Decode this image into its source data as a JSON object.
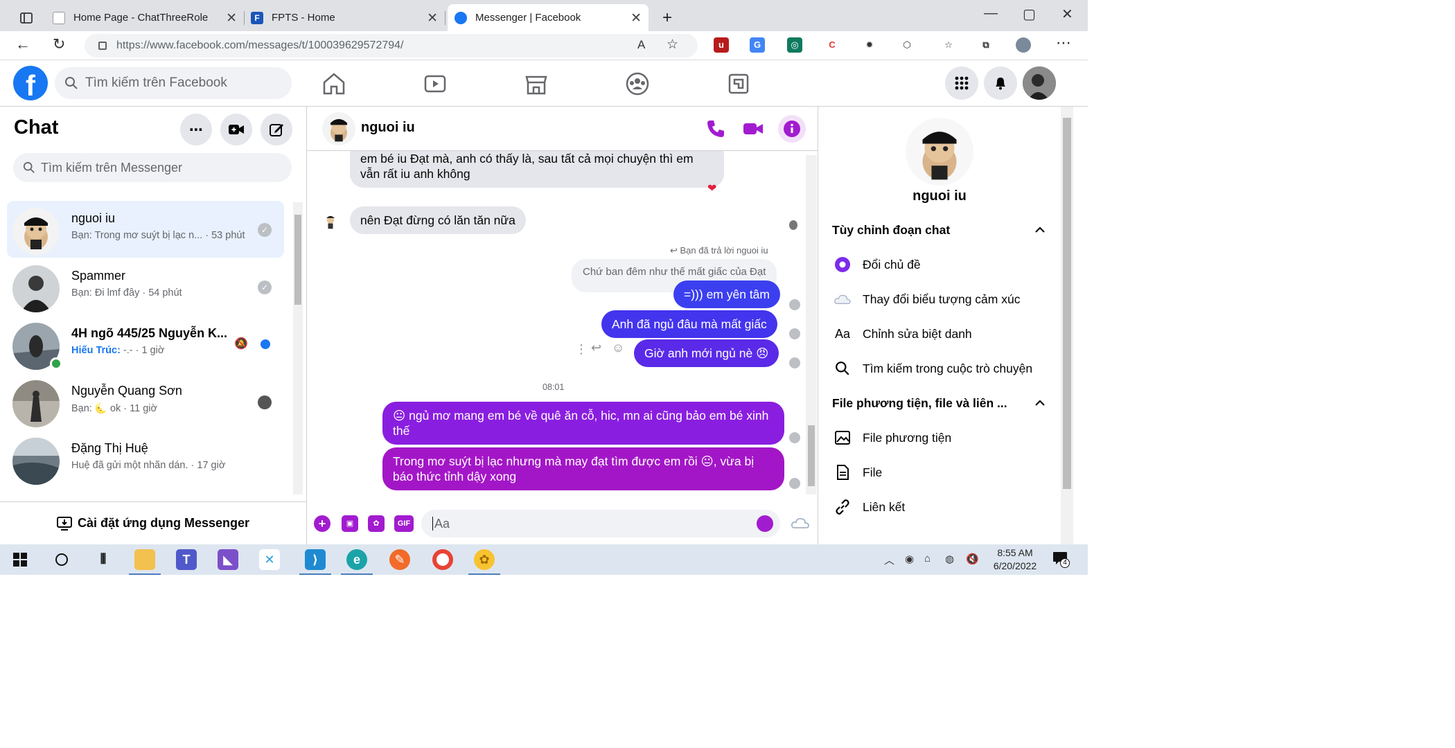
{
  "browser": {
    "tabs": [
      {
        "title": "Home Page - ChatThreeRole",
        "active": false
      },
      {
        "title": "FPTS - Home",
        "active": false
      },
      {
        "title": "Messenger | Facebook",
        "active": true
      }
    ],
    "new_tab": "+",
    "url": "https://www.facebook.com/messages/t/100039629572794/",
    "window_controls": {
      "minimize": "—",
      "maximize": "▢",
      "close": "✕"
    }
  },
  "facebook": {
    "logo": "f",
    "search_placeholder": "Tìm kiếm trên Facebook"
  },
  "chat_list": {
    "title": "Chat",
    "search_placeholder": "Tìm kiếm trên Messenger",
    "conversations": [
      {
        "name": "nguoi iu",
        "preview": "Bạn: Trong mơ suýt bị lạc n... · 53 phút",
        "selected": true
      },
      {
        "name": "Spammer",
        "preview": "Bạn: Đi lmf đây · 54 phút",
        "selected": false
      },
      {
        "name": "4H ngõ 445/25 Nguyễn K...",
        "preview_sender": "Hiếu Trúc:",
        "preview": " -.- · 1 giờ",
        "selected": false,
        "unread": true
      },
      {
        "name": "Nguyễn Quang Sơn",
        "preview": "Bạn: 🌜 ok · 11 giờ",
        "selected": false
      },
      {
        "name": "Đặng Thị Huệ",
        "preview": "Huệ đã gửi một nhãn dán. · 17 giờ",
        "selected": false
      }
    ],
    "install_label": "Cài đặt ứng dụng Messenger"
  },
  "conversation": {
    "contact_name": "nguoi iu",
    "messages": {
      "incoming_1": "em bé iu Đạt mà, anh có thấy là, sau tất cả mọi chuyện thì em vẫn rất iu anh không",
      "incoming_1_reaction": "❤",
      "incoming_2": "nên Đạt đừng có lăn tăn nữa",
      "reply_note": "↩ Bạn đã trả lời nguoi iu",
      "quoted": "Chứ ban đêm như thế mất giấc của Đạt",
      "out_1": "=))) em yên tâm",
      "out_2": "Anh đã ngủ đâu mà mất giấc",
      "out_3": "Giờ anh mới ngủ nè 😠",
      "timestamp": "08:01",
      "out_4": "😐 ngủ mơ mang em bé về quê ăn cỗ, hic, mn ai cũng bảo em bé xinh thế",
      "out_5": "Trong mơ suýt bị lạc nhưng mà may đạt tìm được em rồi 😐, vừa bị báo thức tỉnh dậy xong"
    },
    "input_placeholder": "Aa",
    "composer_icons": [
      "+",
      "▣",
      "✿",
      "GIF"
    ]
  },
  "info_panel": {
    "name": "nguoi iu",
    "section_customize": "Tùy chỉnh đoạn chat",
    "change_theme": "Đổi chủ đề",
    "change_emoji": "Thay đổi biểu tượng cảm xúc",
    "edit_nickname_icon": "Aa",
    "edit_nickname": "Chỉnh sửa biệt danh",
    "search_in_chat": "Tìm kiếm trong cuộc trò chuyện",
    "section_media": "File phương tiện, file và liên ...",
    "media": "File phương tiện",
    "files": "File",
    "links": "Liên kết"
  },
  "taskbar": {
    "time": "8:55 AM",
    "date": "6/20/2022",
    "notification_count": "4"
  },
  "colors": {
    "facebook_blue": "#1877f2",
    "messenger_purple": "#a21ccf",
    "bubble_blue": "#3b3ff0",
    "bubble_violet": "#8a1ee0",
    "bubble_magenta": "#a316c7"
  }
}
